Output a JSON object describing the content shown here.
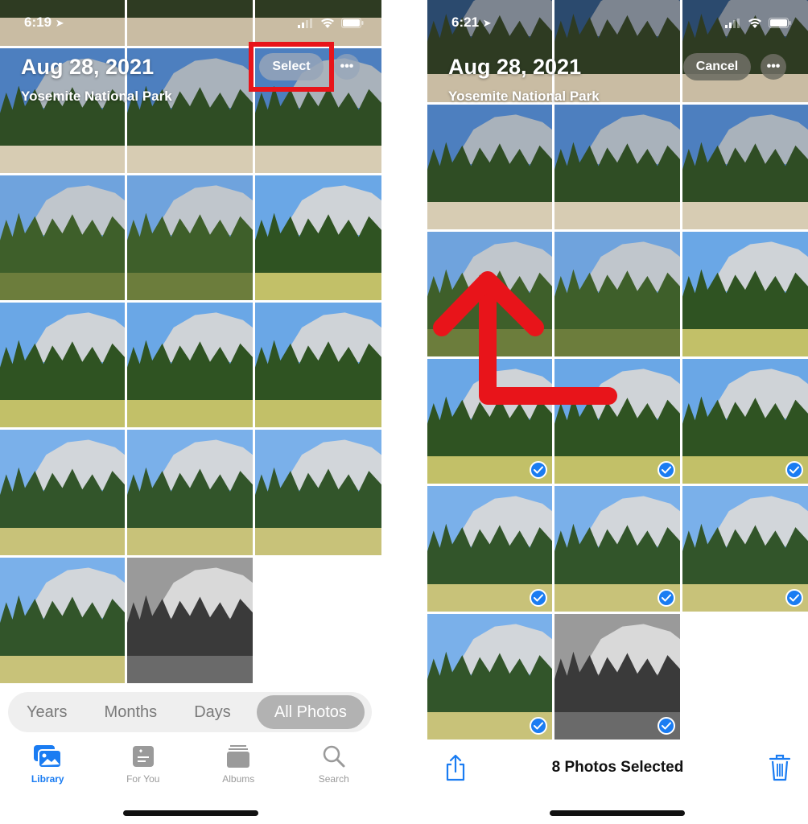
{
  "left_screen": {
    "status_bar": {
      "time": "6:19",
      "location_icon": "location-arrow-icon",
      "signal_icon": "cellular-signal-icon",
      "wifi_icon": "wifi-icon",
      "battery_icon": "battery-icon"
    },
    "header": {
      "date": "Aug 28, 2021",
      "location": "Yosemite National Park",
      "select_label": "Select",
      "more_icon": "ellipsis-icon",
      "more_label": "•••"
    },
    "annotation": {
      "highlight": "red-box-around-select",
      "color": "#e8141a"
    },
    "photo_count": 17,
    "segments": [
      {
        "label": "Years",
        "active": false
      },
      {
        "label": "Months",
        "active": false
      },
      {
        "label": "Days",
        "active": false
      },
      {
        "label": "All Photos",
        "active": true
      }
    ],
    "tabs": [
      {
        "label": "Library",
        "icon": "photo-library-icon",
        "active": true
      },
      {
        "label": "For You",
        "icon": "for-you-icon",
        "active": false
      },
      {
        "label": "Albums",
        "icon": "albums-icon",
        "active": false
      },
      {
        "label": "Search",
        "icon": "search-icon",
        "active": false
      }
    ]
  },
  "right_screen": {
    "status_bar": {
      "time": "6:21",
      "location_icon": "location-arrow-icon",
      "signal_icon": "cellular-signal-icon",
      "wifi_icon": "wifi-icon",
      "battery_icon": "battery-icon"
    },
    "header": {
      "date": "Aug 28, 2021",
      "location": "Yosemite National Park",
      "cancel_label": "Cancel",
      "more_icon": "ellipsis-icon",
      "more_label": "•••"
    },
    "annotation": {
      "shape": "red-arrow-up-swipe",
      "color": "#e8141a"
    },
    "selection_count_label": "8 Photos Selected",
    "share_icon": "share-icon",
    "trash_icon": "trash-icon",
    "selected_tiles": [
      9,
      10,
      11,
      12,
      13,
      14,
      15,
      16
    ]
  },
  "colors": {
    "accent": "#1a7cf2",
    "annotation_red": "#e8141a"
  }
}
